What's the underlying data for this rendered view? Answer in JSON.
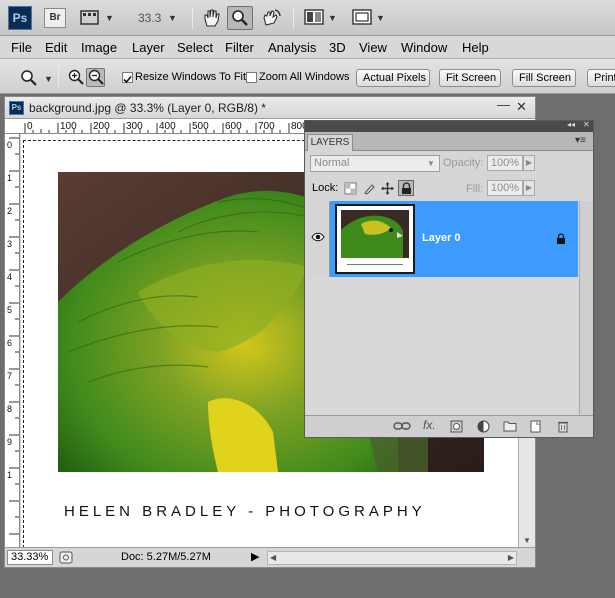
{
  "appbar": {
    "ps_logo": "Ps",
    "br_logo": "Br",
    "zoom_level": "33.3",
    "icons": [
      "layout-icon",
      "hand-icon",
      "zoom-icon",
      "rotate-view-icon",
      "arrange-documents-icon",
      "screen-mode-icon"
    ]
  },
  "menu": [
    "File",
    "Edit",
    "Image",
    "Layer",
    "Select",
    "Filter",
    "Analysis",
    "3D",
    "View",
    "Window",
    "Help"
  ],
  "options": {
    "resize_windows": "Resize Windows To Fit",
    "zoom_all_windows": "Zoom All Windows",
    "actual_pixels": "Actual Pixels",
    "fit_screen": "Fit Screen",
    "fill_screen": "Fill Screen",
    "print_size": "Print"
  },
  "document": {
    "title": "background.jpg @ 33.3% (Layer 0, RGB/8) *",
    "ruler_top": [
      "0",
      "100",
      "200",
      "300",
      "400",
      "500",
      "600",
      "700",
      "800"
    ],
    "ruler_left": [
      "0",
      "1",
      "2",
      "3",
      "4",
      "5",
      "6",
      "7",
      "8",
      "9",
      "1"
    ],
    "caption": "HELEN BRADLEY - PHOTOGRAPHY",
    "status_zoom": "33.33%",
    "status_doc": "Doc: 5.27M/5.27M"
  },
  "layers": {
    "tab_label": "LAYERS",
    "blend_mode": "Normal",
    "opacity_label": "Opacity:",
    "opacity_value": "100%",
    "lock_label": "Lock:",
    "fill_label": "Fill:",
    "fill_value": "100%",
    "layer_name": "Layer 0"
  },
  "colors": {
    "accent_selection": "#3d9bff",
    "parrot_green": "#3f8f1c",
    "parrot_yellow": "#e3d21a"
  }
}
